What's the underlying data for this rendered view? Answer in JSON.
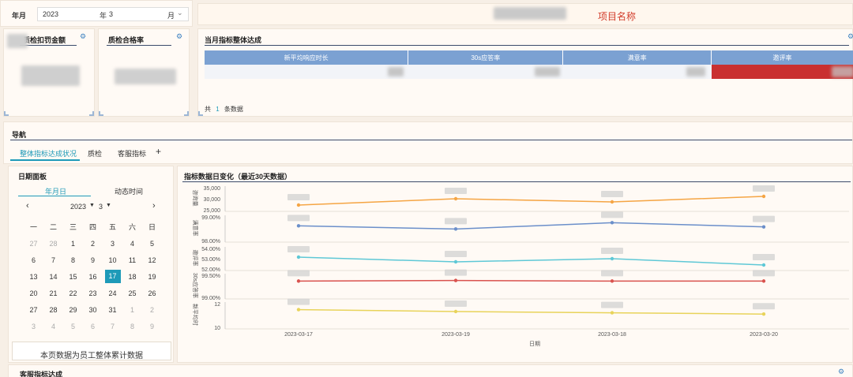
{
  "filter": {
    "year_label": "年月",
    "year_value": "2023",
    "year_suffix": "年",
    "month_value": "3",
    "month_suffix": "月"
  },
  "project_title": "项目名称",
  "kpi": {
    "fine_label": "质检扣罚金额",
    "pass_label": "质检合格率"
  },
  "monthly": {
    "title": "当月指标整体达成",
    "columns": [
      "新平均响应时长",
      "30s应答率",
      "满意率",
      "邀评率"
    ],
    "footer_prefix": "共",
    "footer_count": "1",
    "footer_suffix": "条数据"
  },
  "nav": {
    "title": "导航",
    "tabs": [
      "整体指标达成状况",
      "质检",
      "客服指标"
    ],
    "add": "+"
  },
  "datepanel": {
    "title": "日期面板",
    "tab_active": "年月日",
    "tab_other": "动态时间",
    "year": "2023",
    "month": "3",
    "weekdays": [
      "一",
      "二",
      "三",
      "四",
      "五",
      "六",
      "日"
    ],
    "weeks": [
      [
        "27",
        "28",
        "1",
        "2",
        "3",
        "4",
        "5"
      ],
      [
        "6",
        "7",
        "8",
        "9",
        "10",
        "11",
        "12"
      ],
      [
        "13",
        "14",
        "15",
        "16",
        "17",
        "18",
        "19"
      ],
      [
        "20",
        "21",
        "22",
        "23",
        "24",
        "25",
        "26"
      ],
      [
        "27",
        "28",
        "29",
        "30",
        "31",
        "1",
        "2"
      ],
      [
        "3",
        "4",
        "5",
        "6",
        "7",
        "8",
        "9"
      ]
    ],
    "note": "本页数据为员工整体累计数据"
  },
  "bottom": {
    "title": "客服指标达成"
  },
  "chart_data": {
    "type": "line",
    "title": "指标数据日变化（最近30天数据）",
    "xlabel": "日期",
    "categories": [
      "2023-03-17",
      "2023-03-19",
      "2023-03-18",
      "2023-03-20"
    ],
    "panels": [
      {
        "ylabel": "咨询量",
        "ticks": [
          "35,000",
          "30,000",
          "25,000"
        ],
        "ylim": [
          22000,
          37000
        ],
        "color": "#f5a544",
        "values": [
          25000,
          29000,
          27000,
          30500
        ]
      },
      {
        "ylabel": "满意率",
        "ticks": [
          "99.00%",
          "98.00%"
        ],
        "ylim": [
          97.9,
          99.1
        ],
        "color": "#6b8fca",
        "values": [
          98.6,
          98.45,
          98.75,
          98.55
        ]
      },
      {
        "ylabel": "邀评率",
        "ticks": [
          "54.00%",
          "53.00%",
          "52.00%"
        ],
        "ylim": [
          51.5,
          54.3
        ],
        "color": "#5ec8d6",
        "values": [
          53.0,
          52.4,
          52.8,
          52.0
        ]
      },
      {
        "ylabel": "30s应答率",
        "ticks": [
          "99.50%",
          "99.00%"
        ],
        "ylim": [
          98.9,
          99.7
        ],
        "color": "#d9534f",
        "values": [
          99.45,
          99.47,
          99.45,
          99.45
        ]
      },
      {
        "ylabel": "新平均时",
        "ticks": [
          "12",
          "10"
        ],
        "ylim": [
          9,
          13
        ],
        "color": "#e8d35a",
        "values": [
          11.8,
          11.5,
          11.3,
          11.1
        ]
      }
    ]
  }
}
